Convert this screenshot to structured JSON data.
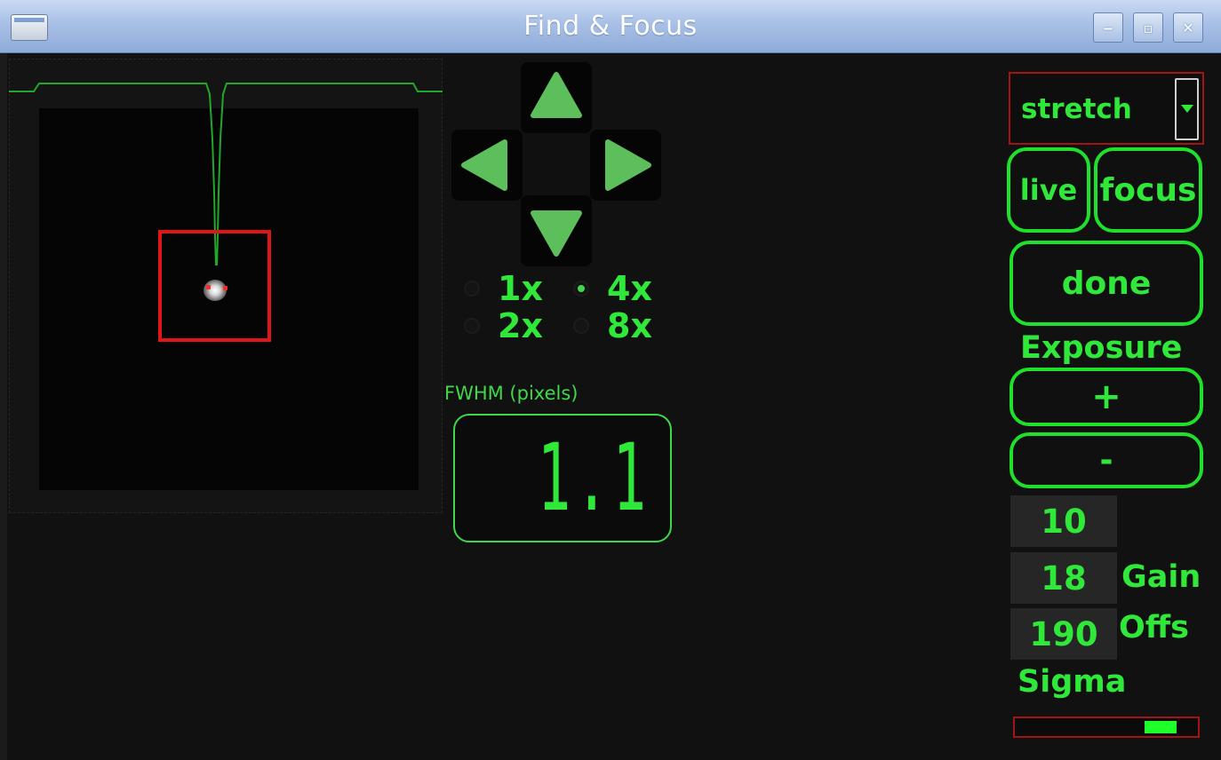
{
  "window": {
    "title": "Find & Focus",
    "controls": {
      "minimize": "‒",
      "maximize": "▫",
      "close": "✕"
    }
  },
  "image_view": {
    "selection_color": "#e01515",
    "profile_color": "#1fa82a"
  },
  "navigation": {
    "icons": [
      "arrow-up-icon",
      "arrow-left-icon",
      "arrow-right-icon",
      "arrow-down-icon"
    ],
    "arrow_color": "#5cbf5c"
  },
  "zoom": {
    "options": [
      "1x",
      "4x",
      "2x",
      "8x"
    ],
    "selected": "4x"
  },
  "fwhm": {
    "label": "FWHM (pixels)",
    "value": "1.1"
  },
  "controls": {
    "stretch_value": "stretch",
    "live_label": "live",
    "focus_label": "focus",
    "done_label": "done",
    "exposure_label": "Exposure",
    "exposure_plus": "+",
    "exposure_minus": "-",
    "exposure_value": "10",
    "gain_value": "18",
    "gain_label": "Gain",
    "offset_value": "190",
    "offset_label": "Offs",
    "sigma_label": "Sigma",
    "sigma_level": 0.86
  },
  "colors": {
    "accent_green": "#2fe83a",
    "border_red": "#a31414",
    "background": "#111111"
  }
}
